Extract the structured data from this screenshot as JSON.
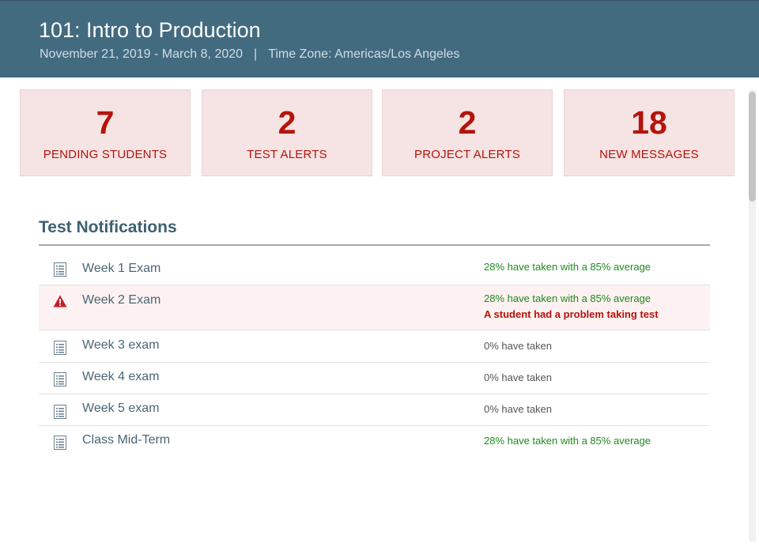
{
  "header": {
    "title": "101: Intro to Production",
    "date_range": "November 21, 2019 - March 8, 2020",
    "separator": "|",
    "timezone": "Time Zone: Americas/Los Angeles"
  },
  "summary_cards": [
    {
      "value": "7",
      "label": "PENDING STUDENTS"
    },
    {
      "value": "2",
      "label": "TEST ALERTS"
    },
    {
      "value": "2",
      "label": "PROJECT ALERTS"
    },
    {
      "value": "18",
      "label": "NEW MESSAGES"
    }
  ],
  "test_notifications": {
    "heading": "Test Notifications",
    "items": [
      {
        "name": "Week 1 Exam",
        "icon": "document-list-icon",
        "status": "28% have taken with a 85% average",
        "status_color": "#1f8a1f"
      },
      {
        "name": "Week 2 Exam",
        "icon": "warning-triangle-icon",
        "status": "28% have taken with a 85% average",
        "status_color": "#1f8a1f",
        "alert": "A student had a problem taking test"
      },
      {
        "name": "Week 3 exam",
        "icon": "document-list-icon",
        "status": "0% have taken",
        "status_color": "#555555"
      },
      {
        "name": "Week 4 exam",
        "icon": "document-list-icon",
        "status": "0% have taken",
        "status_color": "#555555"
      },
      {
        "name": "Week 5 exam",
        "icon": "document-list-icon",
        "status": "0% have taken",
        "status_color": "#555555"
      },
      {
        "name": "Class Mid-Term",
        "icon": "document-list-icon",
        "status": "28% have taken with a 85% average",
        "status_color": "#1f8a1f"
      }
    ]
  },
  "colors": {
    "header_bg": "#436b80",
    "card_bg": "#f6e3e3",
    "alert_red": "#b3140c",
    "success_green": "#1f8a1f"
  }
}
